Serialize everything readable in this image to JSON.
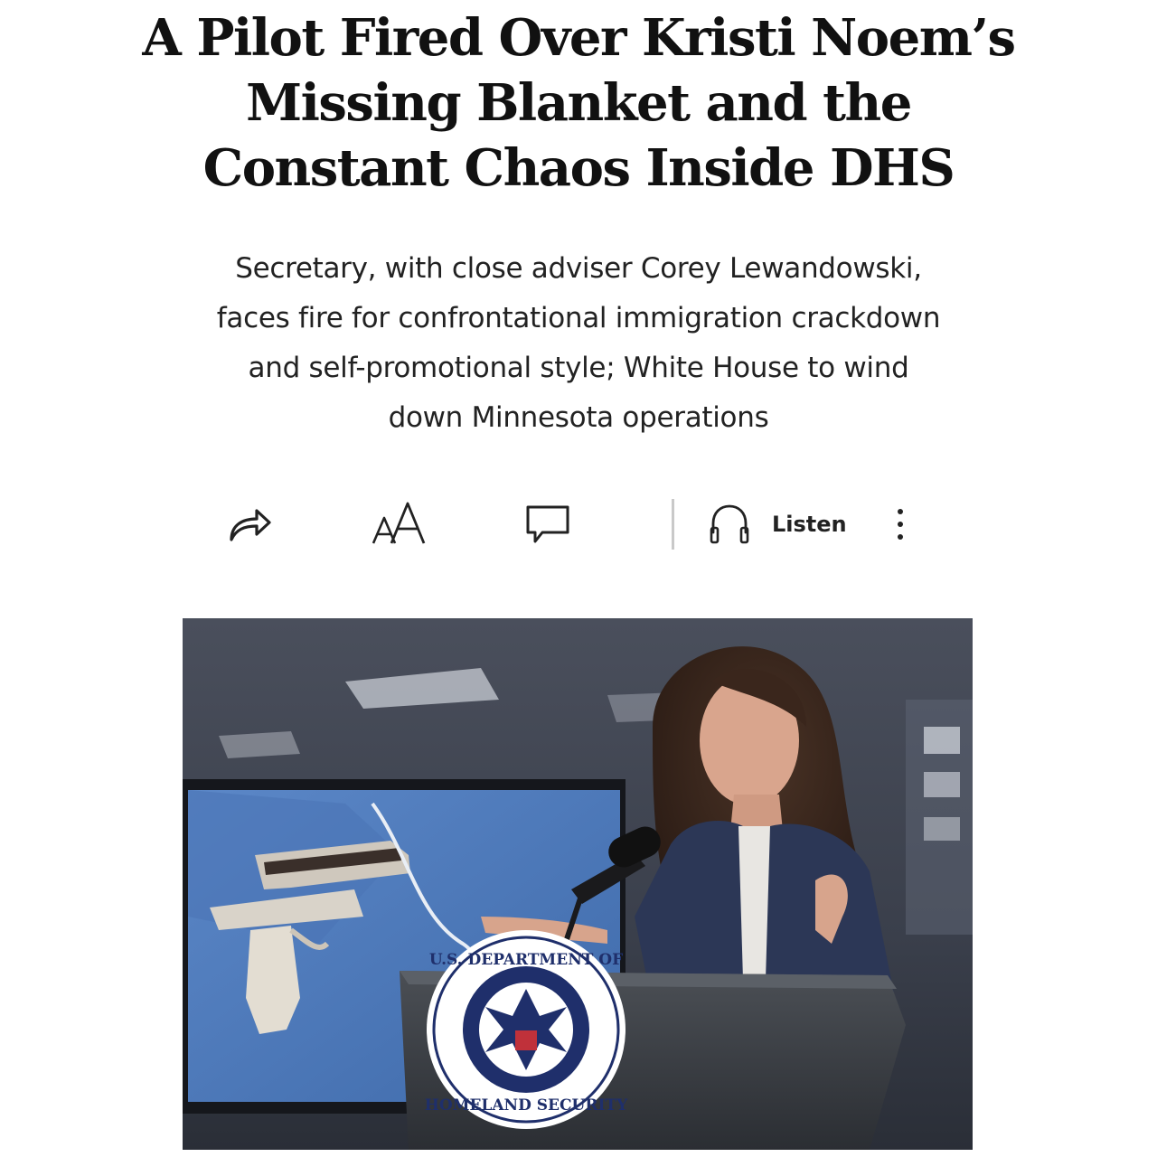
{
  "article": {
    "headline": "A Pilot Fired Over Kristi Noem’s Missing Blanket and the Constant Chaos Inside DHS",
    "dek": "Secretary, with close adviser Corey Lewandowski, faces fire for confrontational immigration crackdown and self-promotional style; White House to wind down Minnesota operations"
  },
  "toolbar": {
    "share_icon": "share-arrow-icon",
    "text_size_icon": "text-size-icon",
    "comment_icon": "comment-bubble-icon",
    "listen_icon": "headphones-icon",
    "listen_label": "Listen",
    "more_icon": "vertical-ellipsis-icon"
  },
  "hero_image": {
    "seal_text_top": "U.S. DEPARTMENT OF",
    "seal_text_bottom": "HOMELAND SECURITY"
  },
  "colors": {
    "text": "#111111",
    "divider": "#c9c9c9",
    "background": "#ffffff"
  }
}
